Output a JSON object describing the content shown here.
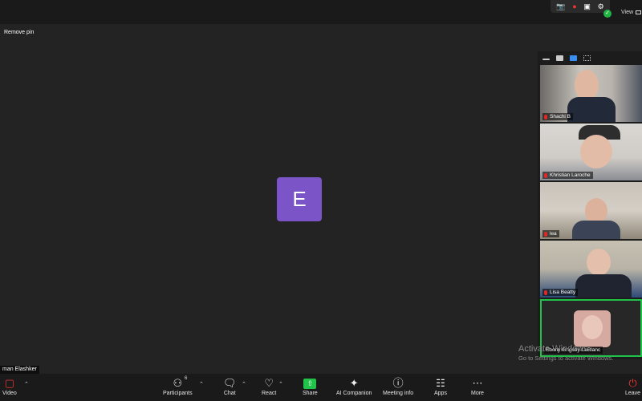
{
  "top": {
    "view_label": "View"
  },
  "stage": {
    "remove_pin_label": "Remove pin",
    "avatar_initial": "E",
    "avatar_color": "#7b55c8",
    "active_speaker_name": "man Elashker"
  },
  "gallery": {
    "participants": [
      {
        "name": "Shachi B",
        "muted": true
      },
      {
        "name": "Khristian Laroche",
        "muted": true
      },
      {
        "name": "lea",
        "muted": true
      },
      {
        "name": "Lisa Beatty",
        "muted": true
      },
      {
        "name": "Ebony Grigsby-LeBlanc",
        "muted": false,
        "active": true
      }
    ]
  },
  "watermark": {
    "title": "Activate Windows",
    "subtitle": "Go to Settings to activate Windows."
  },
  "toolbar": {
    "video_label": "Video",
    "participants_label": "Participants",
    "participants_count": "6",
    "chat_label": "Chat",
    "react_label": "React",
    "share_label": "Share",
    "ai_label": "AI Companion",
    "meeting_info_label": "Meeting info",
    "apps_label": "Apps",
    "more_label": "More",
    "leave_label": "Leave"
  },
  "colors": {
    "share_green": "#21c24a",
    "active_border": "#21c24a",
    "muted_red": "#e02828"
  }
}
